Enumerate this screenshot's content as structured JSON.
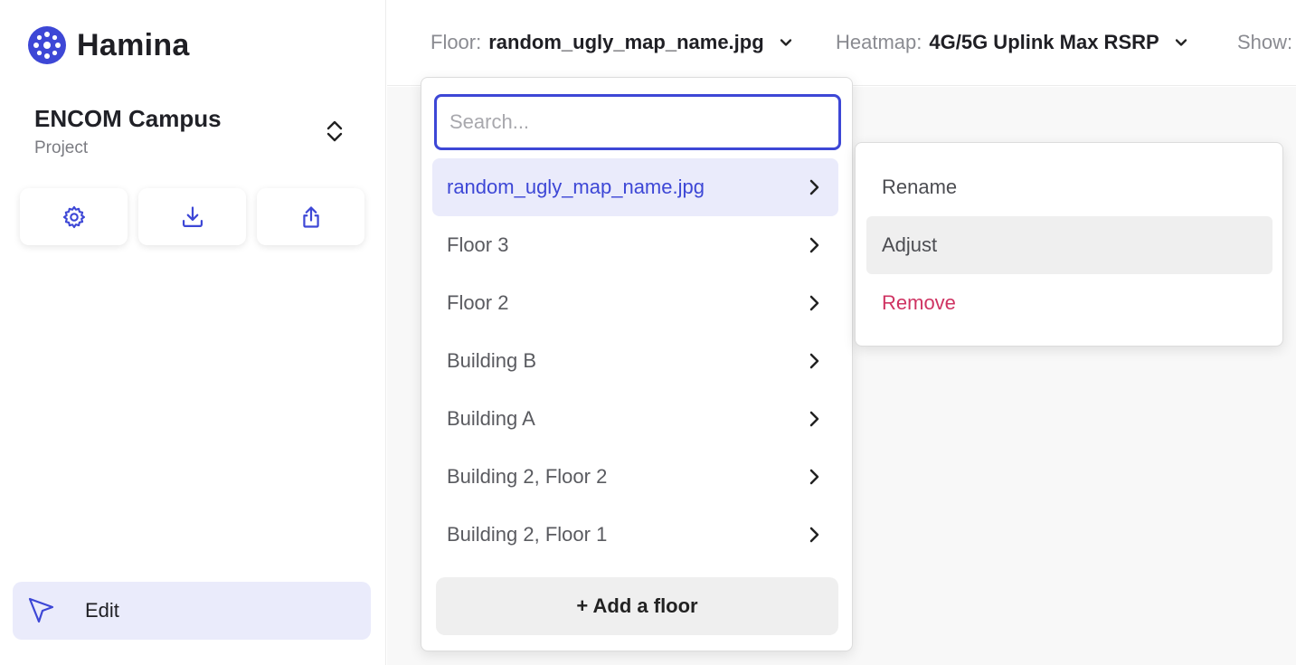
{
  "brand": {
    "name": "Hamina",
    "accent": "#3d47d6"
  },
  "project": {
    "name": "ENCOM Campus",
    "subtitle": "Project"
  },
  "sidebar_actions": [
    {
      "icon": "gear-icon"
    },
    {
      "icon": "download-icon"
    },
    {
      "icon": "share-icon"
    }
  ],
  "edit": {
    "label": "Edit",
    "icon": "cursor-icon"
  },
  "topbar": {
    "floor": {
      "label": "Floor:",
      "value": "random_ugly_map_name.jpg"
    },
    "heatmap": {
      "label": "Heatmap:",
      "value": "4G/5G Uplink Max RSRP"
    },
    "show": {
      "label": "Show:"
    }
  },
  "floor_dropdown": {
    "search_placeholder": "Search...",
    "items": [
      {
        "label": "random_ugly_map_name.jpg",
        "active": true
      },
      {
        "label": "Floor 3"
      },
      {
        "label": "Floor 2"
      },
      {
        "label": "Building B"
      },
      {
        "label": "Building A"
      },
      {
        "label": "Building 2, Floor 2"
      },
      {
        "label": "Building 2, Floor 1"
      }
    ],
    "add_label": "+ Add a floor"
  },
  "context_menu": {
    "items": [
      {
        "label": "Rename"
      },
      {
        "label": "Adjust"
      },
      {
        "label": "Remove"
      }
    ],
    "danger_color": "#cf3362"
  }
}
